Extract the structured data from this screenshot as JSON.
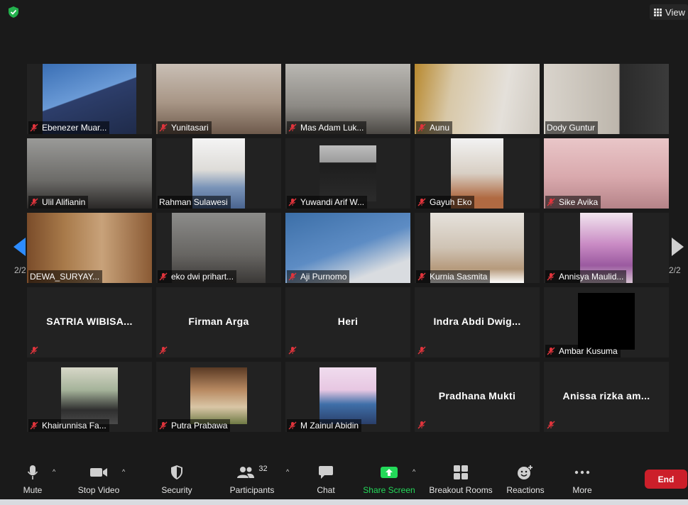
{
  "window": {
    "view_label": "View"
  },
  "pager": {
    "left": "2/2",
    "right": "2/2"
  },
  "participants": [
    {
      "name": "Ebenezer Muar...",
      "video": true
    },
    {
      "name": "Yunitasari",
      "video": true
    },
    {
      "name": "Mas Adam Luk...",
      "video": true
    },
    {
      "name": "Aunu",
      "video": true
    },
    {
      "name": "Dody Guntur",
      "video": true
    },
    {
      "name": "Ulil Alifianin",
      "video": true
    },
    {
      "name": "Rahman Sulawesi",
      "video": true
    },
    {
      "name": "Yuwandi Arif W...",
      "video": true
    },
    {
      "name": "Gayuh Eko",
      "video": true
    },
    {
      "name": "Sike Avika",
      "video": true
    },
    {
      "name": "DEWA_SURYAY...",
      "video": true
    },
    {
      "name": "eko dwi prihart...",
      "video": true
    },
    {
      "name": "Aji Purnomo",
      "video": true
    },
    {
      "name": "Kurnia Sasmita",
      "video": true
    },
    {
      "name": "Annisya Maulid...",
      "video": true
    },
    {
      "name": "SATRIA WIBISA...",
      "video": false
    },
    {
      "name": "Firman Arga",
      "video": false
    },
    {
      "name": "Heri",
      "video": false
    },
    {
      "name": "Indra Abdi Dwig...",
      "video": false
    },
    {
      "name": "Ambar Kusuma",
      "video": true
    },
    {
      "name": "Khairunnisa Fa...",
      "video": true
    },
    {
      "name": "Putra Prabawa",
      "video": true
    },
    {
      "name": "M Zainul Abidin",
      "video": true
    },
    {
      "name": "Pradhana Mukti",
      "video": false
    },
    {
      "name": "Anissa rizka am...",
      "video": false
    }
  ],
  "toolbar": {
    "mute": "Mute",
    "stop_video": "Stop Video",
    "security": "Security",
    "participants": "Participants",
    "participants_count": "32",
    "chat": "Chat",
    "share_screen": "Share Screen",
    "breakout_rooms": "Breakout Rooms",
    "reactions": "Reactions",
    "more": "More",
    "end": "End"
  },
  "colors": {
    "accent_green": "#23d959",
    "end_red": "#cc1f2a",
    "mic_muted": "#e0343c"
  }
}
